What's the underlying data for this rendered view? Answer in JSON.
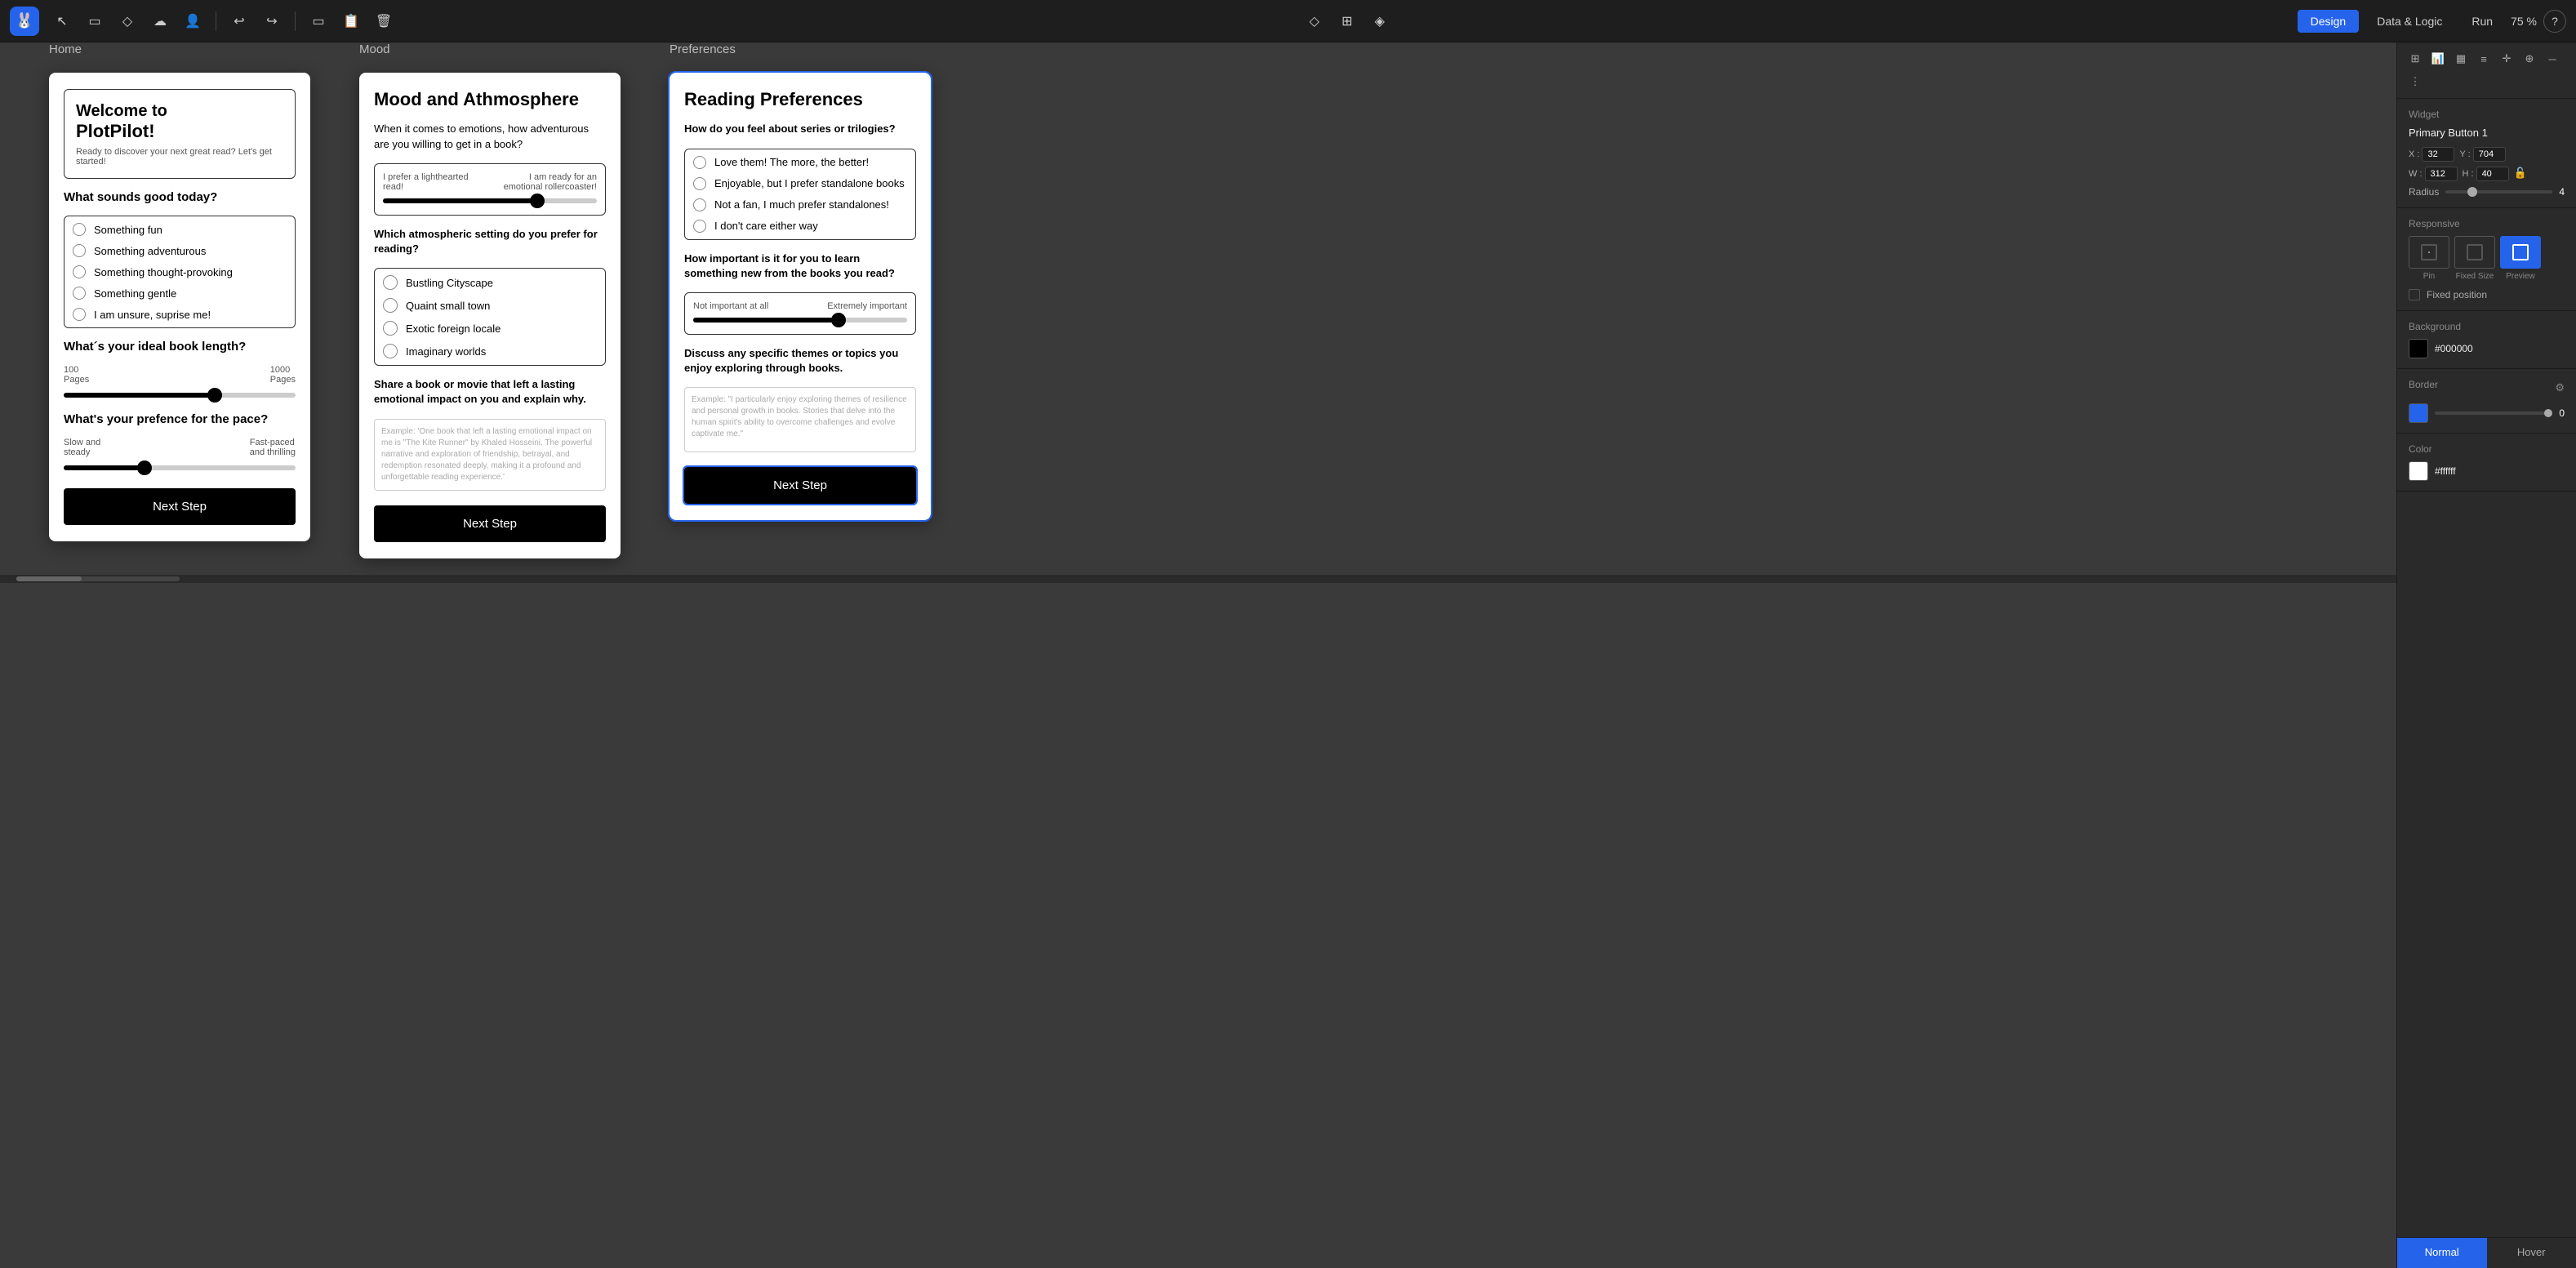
{
  "topbar": {
    "logo": "🐰",
    "tools": [
      "↖",
      "▭",
      "◇",
      "☁",
      "👤"
    ],
    "history": [
      "↩",
      "↪"
    ],
    "actions": [
      "▭",
      "📋",
      "🗑"
    ],
    "center_tools": [
      "◇",
      "⊞",
      "◈"
    ],
    "tabs": {
      "design": "Design",
      "data_logic": "Data & Logic",
      "run": "Run"
    },
    "zoom": "75 %",
    "help": "?"
  },
  "screens": {
    "home": {
      "label": "Home",
      "welcome_title": "Welcome to\nPlotPilot!",
      "welcome_subtitle": "Ready to discover your next great read? Let's get started!",
      "question1": "What sounds good today?",
      "options": [
        "Something fun",
        "Something adventurous",
        "Something thought-provoking",
        "Something gentle",
        "I am unsure, suprise me!"
      ],
      "question2": "What´s your ideal book length?",
      "slider2_min": "100\nPages",
      "slider2_max": "1000\nPages",
      "slider2_fill": "65%",
      "slider2_thumb": "63%",
      "question3": "What's your prefence for the pace?",
      "slider3_min": "Slow and\nsteady",
      "slider3_max": "Fast-paced\nand thrilling",
      "slider3_fill": "35%",
      "slider3_thumb": "33%",
      "next_btn": "Next Step"
    },
    "mood": {
      "label": "Mood",
      "title": "Mood and Athmosphere",
      "question1": "When it comes to emotions, how adventurous are you willing to get in a book?",
      "slider_left": "I prefer a lighthearted read!",
      "slider_right": "I am ready for an emotional rollercoaster!",
      "slider_fill": "72%",
      "slider_thumb": "70%",
      "question2": "Which atmospheric setting do you prefer for reading?",
      "settings": [
        "Bustling Cityscape",
        "Quaint small town",
        "Exotic foreign locale",
        "Imaginary worlds"
      ],
      "question3": "Share a book or movie that left a lasting emotional impact on you and explain why.",
      "textarea_placeholder": "Example: 'One book that left a lasting emotional impact on me is \"The Kite Runner\" by Khaled Hosseini. The powerful narrative and exploration of friendship, betrayal, and redemption resonated deeply, making it a profound and unforgettable reading experience.'",
      "next_btn": "Next Step"
    },
    "preferences": {
      "label": "Preferences",
      "title": "Reading Preferences",
      "question1": "How do you feel about series or trilogies?",
      "series_options": [
        "Love them! The more, the better!",
        "Enjoyable, but I prefer standalone books",
        "Not a fan, I much prefer standalones!",
        "I don't care either way"
      ],
      "question2": "How important is it for you to learn something new from the books you read?",
      "slider_left": "Not important\nat all",
      "slider_right": "Extremely\nimportant",
      "slider_fill": "68%",
      "slider_thumb": "66%",
      "question3": "Discuss any specific themes or topics you enjoy exploring through books.",
      "textarea_placeholder": "Example: \"I particularly enjoy exploring themes of resilience and personal growth in books. Stories that delve into the human spirit's ability to overcome challenges and evolve captivate me.\"",
      "next_btn": "Next Step"
    }
  },
  "right_panel": {
    "widget_label": "Widget",
    "widget_name": "Primary Button 1",
    "x_label": "X :",
    "x_val": "32",
    "y_label": "Y :",
    "y_val": "704",
    "w_label": "W :",
    "w_val": "312",
    "h_label": "H :",
    "h_val": "40",
    "radius_label": "Radius",
    "radius_val": "4",
    "responsive_label": "Responsive",
    "resp_options": [
      "Pin",
      "Fixed Size",
      "Preview"
    ],
    "fixed_position_label": "Fixed position",
    "background_label": "Background",
    "bg_color": "#000000",
    "border_label": "Border",
    "border_color": "#2563eb",
    "border_val": "0",
    "color_label": "Color",
    "color_val": "#ffffff",
    "state_normal": "Normal",
    "state_hover": "Hover"
  }
}
